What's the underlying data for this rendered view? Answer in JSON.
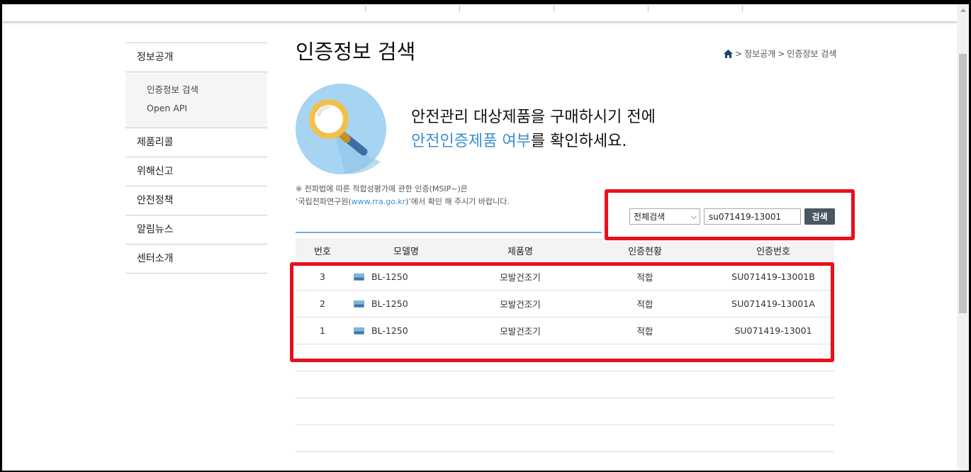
{
  "sidebar": {
    "items": [
      {
        "label": "정보공개"
      },
      {
        "label": "제품리콜"
      },
      {
        "label": "위해신고"
      },
      {
        "label": "안전정책"
      },
      {
        "label": "알림뉴스"
      },
      {
        "label": "센터소개"
      }
    ],
    "sub_items": [
      {
        "label": "인증정보 검색"
      },
      {
        "label": "Open API"
      }
    ]
  },
  "page": {
    "title": "인증정보 검색",
    "breadcrumb": [
      "정보공개",
      "인증정보 검색"
    ]
  },
  "hero": {
    "line1": "안전관리 대상제품을 구매하시기 전에",
    "line2_accent": "안전인증제품 여부",
    "line2_rest": "를 확인하세요."
  },
  "notice": {
    "line1": "※ 전파법에 따른 적합성평가에 관한 인증(MSIP~)은",
    "line2_prefix": "‘국립전파연구원(",
    "line2_link": "www.rra.go.kr",
    "line2_suffix": ")’에서 확인 해 주시기 바랍니다."
  },
  "search": {
    "select_value": "전체검색",
    "input_value": "su071419-13001",
    "button_label": "검색"
  },
  "table": {
    "headers": [
      "번호",
      "모델명",
      "제품명",
      "인증현황",
      "인증번호"
    ],
    "rows": [
      {
        "no": "3",
        "model": "BL-1250",
        "product": "모발건조기",
        "status": "적합",
        "cert": "SU071419-13001B"
      },
      {
        "no": "2",
        "model": "BL-1250",
        "product": "모발건조기",
        "status": "적합",
        "cert": "SU071419-13001A"
      },
      {
        "no": "1",
        "model": "BL-1250",
        "product": "모발건조기",
        "status": "적합",
        "cert": "SU071419-13001"
      }
    ]
  },
  "colors": {
    "accent": "#3b8fd2",
    "annotation_red": "#e8101c",
    "search_button": "#4a5660"
  }
}
